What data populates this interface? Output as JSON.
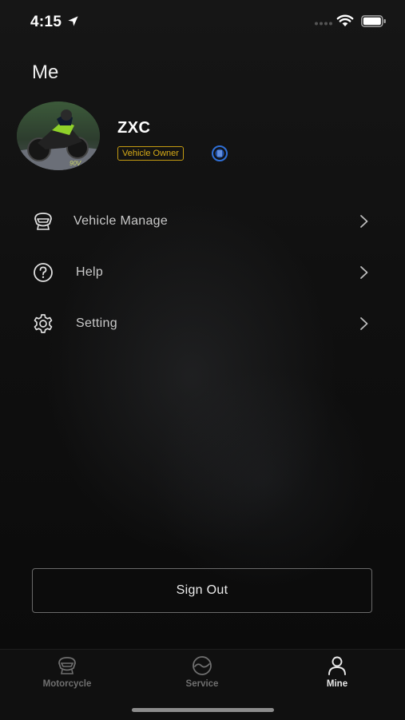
{
  "status_bar": {
    "time": "4:15"
  },
  "page": {
    "title": "Me"
  },
  "profile": {
    "name": "ZXC",
    "role_badge": "Vehicle Owner"
  },
  "menu": [
    {
      "label": "Vehicle Manage",
      "icon": "motorcycle-helmet-icon"
    },
    {
      "label": "Help",
      "icon": "help-icon"
    },
    {
      "label": "Setting",
      "icon": "gear-icon"
    }
  ],
  "actions": {
    "sign_out": "Sign Out"
  },
  "tabbar": {
    "tabs": [
      {
        "label": "Motorcycle",
        "icon": "motorcycle-icon",
        "active": false
      },
      {
        "label": "Service",
        "icon": "service-icon",
        "active": false
      },
      {
        "label": "Mine",
        "icon": "person-icon",
        "active": true
      }
    ]
  },
  "colors": {
    "background": "#0d0d0d",
    "badge": "#d7ab17",
    "badge_icon": "#2f6fd6"
  }
}
